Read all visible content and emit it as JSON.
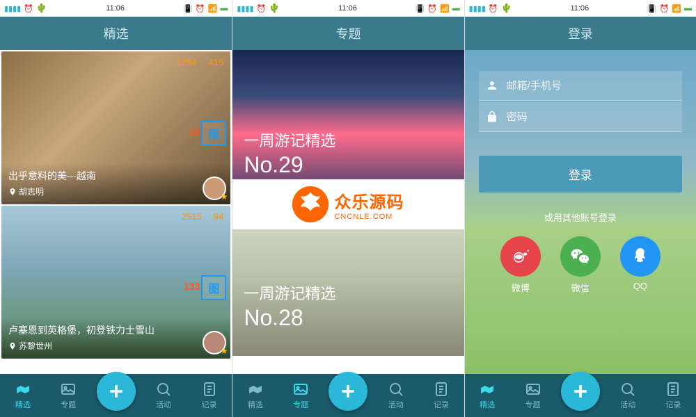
{
  "statusbar": {
    "time": "11:06"
  },
  "screens": {
    "featured": {
      "header": "精选",
      "cards": [
        {
          "views": "1284",
          "likes": "415",
          "badge_num": "18",
          "badge_char": "图",
          "title": "出乎意料的美---越南",
          "location": "胡志明"
        },
        {
          "views": "2515",
          "likes": "94",
          "badge_num": "133",
          "badge_char": "图",
          "title": "卢塞恩到英格堡，初登铁力士雪山",
          "location": "苏黎世州"
        }
      ]
    },
    "topics": {
      "header": "专题",
      "cards": [
        {
          "line1": "一周游记精选",
          "line2": "No.29"
        },
        {
          "line1": "一周游记精选",
          "line2": "No.28"
        }
      ],
      "logo": {
        "cn": "众乐源码",
        "en": "CNCNLE.COM"
      }
    },
    "login": {
      "header": "登录",
      "email_placeholder": "邮箱/手机号",
      "password_placeholder": "密码",
      "login_btn": "登录",
      "alt_label": "或用其他账号登录",
      "social": {
        "weibo": "微博",
        "wechat": "微信",
        "qq": "QQ"
      }
    }
  },
  "tabs": {
    "featured": "精选",
    "topics": "专题",
    "activity": "活动",
    "records": "记录"
  }
}
